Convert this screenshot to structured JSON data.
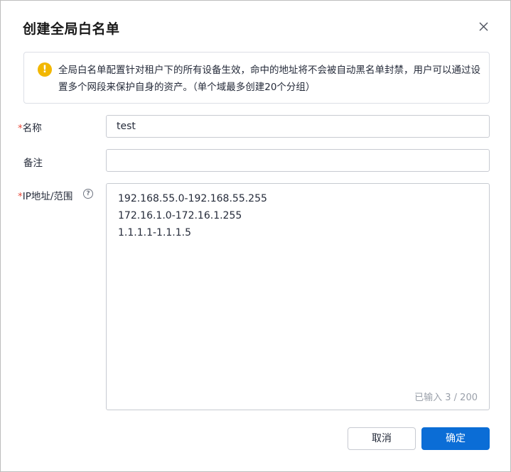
{
  "dialog": {
    "title": "创建全局白名单",
    "close_icon": "close-icon"
  },
  "notice": {
    "icon": "warning-icon",
    "icon_glyph": "!",
    "text": "全局白名单配置针对租户下的所有设备生效，命中的地址将不会被自动黑名单封禁，用户可以通过设置多个网段来保护自身的资产。（单个域最多创建20个分组）"
  },
  "form": {
    "name": {
      "required_mark": "*",
      "label": "名称",
      "value": "test"
    },
    "remark": {
      "label": "备注",
      "value": ""
    },
    "ip": {
      "required_mark": "*",
      "label": "IP地址/范围",
      "help_icon": "question-circle-icon",
      "lines": [
        "192.168.55.0-192.168.55.255",
        "172.16.1.0-172.16.1.255",
        "1.1.1.1-1.1.1.5"
      ],
      "counter": "已输入 3 / 200"
    }
  },
  "footer": {
    "cancel_label": "取消",
    "ok_label": "确定"
  },
  "colors": {
    "primary": "#0b6dd6",
    "warning": "#f2b700",
    "required": "#e84b3c"
  }
}
